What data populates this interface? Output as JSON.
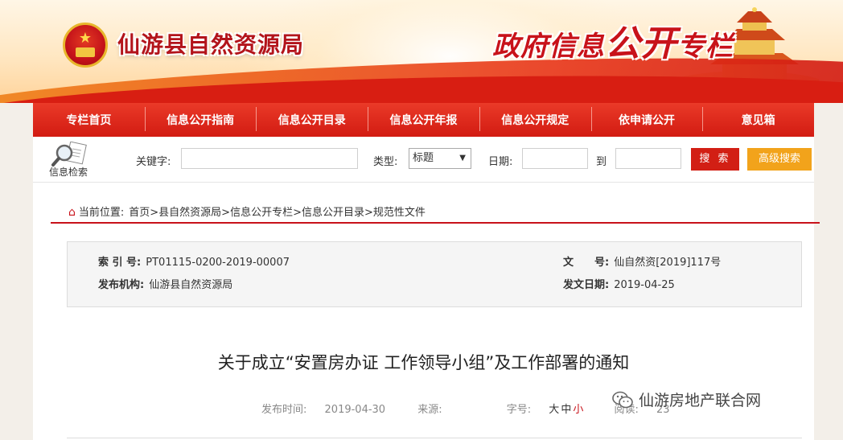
{
  "header": {
    "org_name": "仙游县自然资源局",
    "zone_title_part1": "政府信息",
    "zone_title_part2": "公开",
    "zone_title_part3": "专栏"
  },
  "nav": {
    "items": [
      "专栏首页",
      "信息公开指南",
      "信息公开目录",
      "信息公开年报",
      "信息公开规定",
      "依申请公开",
      "意见箱"
    ]
  },
  "search": {
    "icon_label": "信息检索",
    "keyword_label": "关键字:",
    "keyword_value": "",
    "type_label": "类型:",
    "type_selected": "标题",
    "date_label": "日期:",
    "date_from": "",
    "to_label": "到",
    "date_to": "",
    "search_button": "搜 索",
    "advanced_button": "高级搜索"
  },
  "breadcrumb": {
    "prefix": "当前位置:",
    "path": "首页>县自然资源局>信息公开专栏>信息公开目录>规范性文件"
  },
  "meta": {
    "index_label": "索 引 号:",
    "index_value": "PT01115-0200-2019-00007",
    "doc_no_label": "文　　号:",
    "doc_no_value": "仙自然资[2019]117号",
    "publisher_label": "发布机构:",
    "publisher_value": "仙游县自然资源局",
    "issue_date_label": "发文日期:",
    "issue_date_value": "2019-04-25"
  },
  "article": {
    "title": "关于成立“安置房办证 工作领导小组”及工作部署的通知",
    "publish_time_label": "发布时间:",
    "publish_time": "2019-04-30",
    "source_label": "来源:",
    "source_value": "",
    "font_size_label": "字号:",
    "size_large": "大",
    "size_medium": "中",
    "size_small": "小",
    "reads_label": "阅读:",
    "reads_value": "23"
  },
  "watermark": {
    "text": "仙游房地产联合网"
  },
  "colors": {
    "brand_red": "#d21b12",
    "accent_orange": "#f2a31b"
  }
}
